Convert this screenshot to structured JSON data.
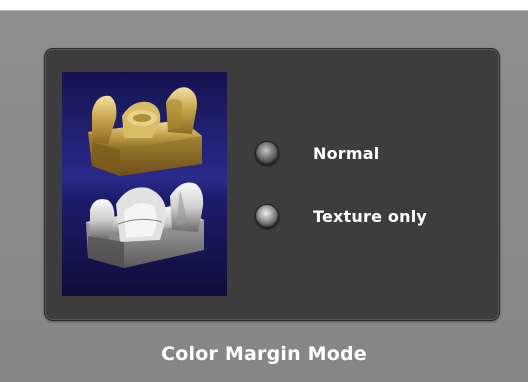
{
  "window": {
    "title": "Color Margin Mode"
  },
  "preview": {
    "icon": "tooth-model-preview-icon"
  },
  "options": [
    {
      "label": "Normal",
      "selected": true
    },
    {
      "label": "Texture only",
      "selected": false
    }
  ],
  "colors": {
    "background": "#8a8a8a",
    "panel": "#3d3d3d",
    "preview_top": "#141450",
    "preview_mid": "#2a2a8a",
    "label_text": "#ffffff",
    "model_gold": "#c8a84a",
    "model_white": "#d8d8d8"
  }
}
